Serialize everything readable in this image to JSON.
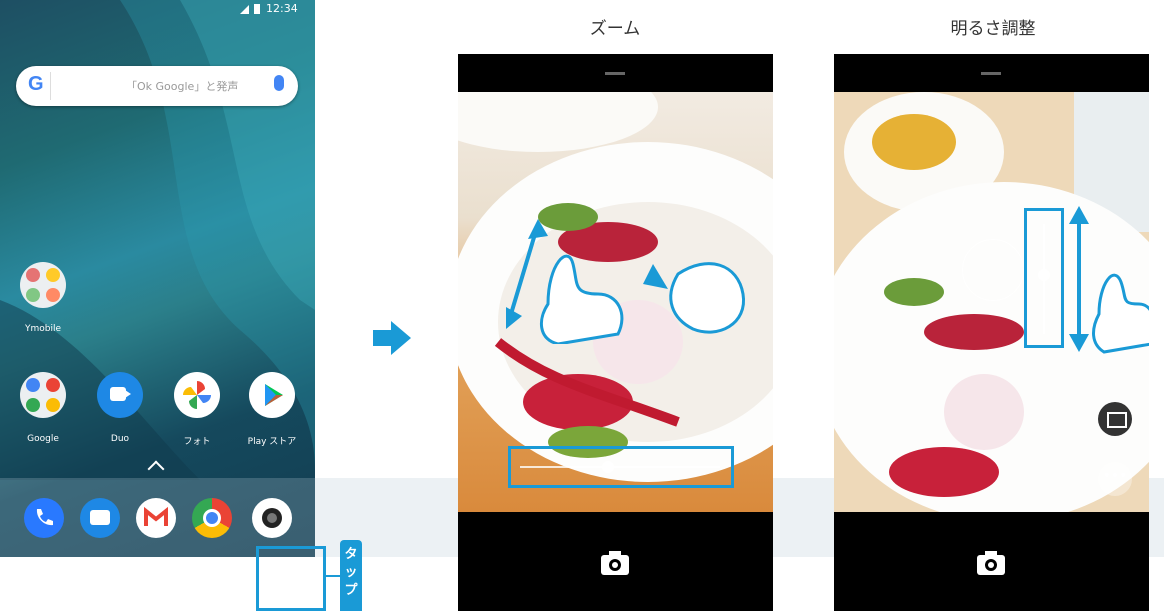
{
  "captions": {
    "zoom": "ズーム",
    "brightness": "明るさ調整"
  },
  "home": {
    "status_time": "12:34",
    "search_hint": "「Ok Google」と発声",
    "folder1_label": "Ymobile",
    "apps": [
      {
        "label": "Google",
        "icon": "google-folder-icon"
      },
      {
        "label": "Duo",
        "icon": "duo-icon"
      },
      {
        "label": "フォト",
        "icon": "photos-icon"
      },
      {
        "label": "Play ストア",
        "icon": "play-store-icon"
      }
    ],
    "dock": [
      "phone-icon",
      "messages-icon",
      "gmail-icon",
      "chrome-icon",
      "camera-icon"
    ],
    "tap_label": "タップ"
  },
  "colors": {
    "highlight": "#1a9ad6",
    "arrow": "#1a9ad6"
  }
}
